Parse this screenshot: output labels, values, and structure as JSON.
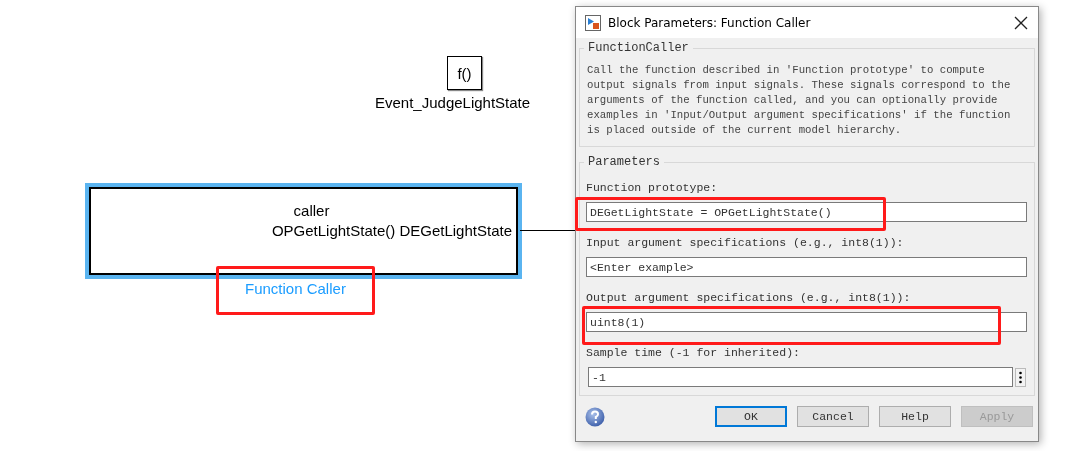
{
  "canvas": {
    "event_block": {
      "symbol": "f()",
      "label": "Event_JudgeLightState"
    },
    "caller_block": {
      "selected": true,
      "lines": [
        "caller",
        "OPGetLightState()  DEGetLightState"
      ],
      "label": "Function Caller"
    }
  },
  "dialog": {
    "title": "Block Parameters: Function Caller",
    "description_group": {
      "title": "FunctionCaller",
      "text": "Call the function described in 'Function prototype' to compute output signals from input signals. These signals correspond to the arguments of the function called, and you can optionally provide examples in 'Input/Output argument specifications' if the function is placed outside of the current model hierarchy."
    },
    "parameters_group": {
      "title": "Parameters",
      "fields": [
        {
          "kind": "text",
          "label": "Function prototype:",
          "value": "DEGetLightState = OPGetLightState()"
        },
        {
          "kind": "text",
          "label": "Input argument specifications (e.g., int8(1)):",
          "placeholder": "<Enter example>"
        },
        {
          "kind": "text",
          "label": "Output argument specifications (e.g., int8(1)):",
          "value": "uint8(1)"
        },
        {
          "kind": "menu",
          "label": "Sample time (-1 for inherited):",
          "value": "-1"
        }
      ]
    },
    "buttons": [
      {
        "label": "OK",
        "focused": true,
        "disabled": false
      },
      {
        "label": "Cancel",
        "focused": false,
        "disabled": false
      },
      {
        "label": "Help",
        "focused": false,
        "disabled": false
      },
      {
        "label": "Apply",
        "focused": false,
        "disabled": true
      }
    ]
  }
}
